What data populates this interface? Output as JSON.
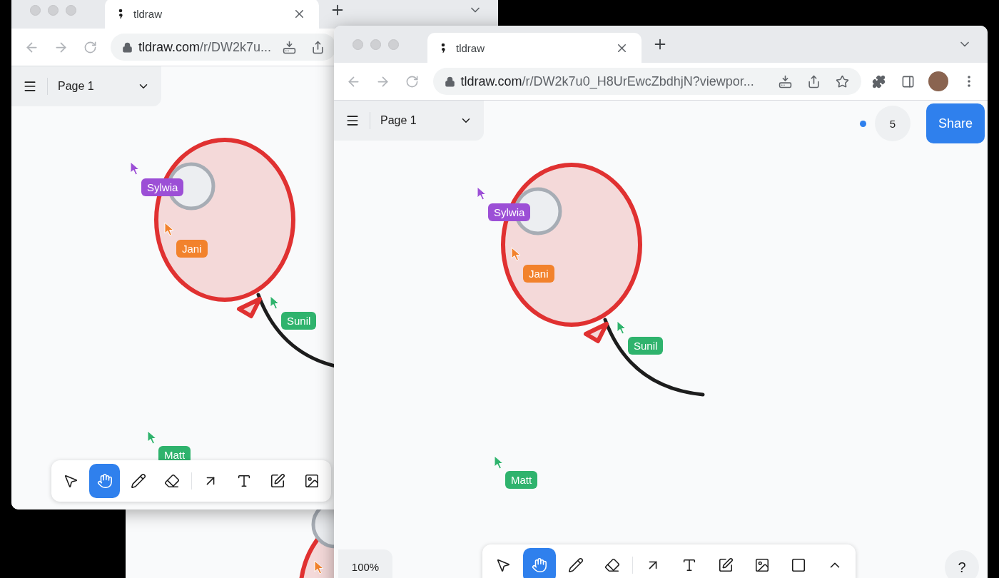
{
  "windows": [
    {
      "tab": {
        "title": "tldraw"
      },
      "url": {
        "host": "tldraw.com",
        "path": "/r/DW2k7u..."
      },
      "page_menu": {
        "label": "Page 1"
      },
      "cursors": [
        {
          "name": "Sylwia",
          "color": "#9c4fd6"
        },
        {
          "name": "Jani",
          "color": "#f2822c"
        },
        {
          "name": "Sunil",
          "color": "#2fb36d"
        },
        {
          "name": "Matt",
          "color": "#2fb36d"
        }
      ],
      "tools": [
        {
          "kind": "select",
          "selected": false
        },
        {
          "kind": "hand",
          "selected": true
        },
        {
          "kind": "draw",
          "selected": false
        },
        {
          "kind": "eraser",
          "selected": false
        },
        {
          "kind": "arrow",
          "selected": false
        },
        {
          "kind": "text",
          "selected": false
        },
        {
          "kind": "note",
          "selected": false
        },
        {
          "kind": "image",
          "selected": false
        }
      ]
    },
    {
      "tab": {
        "title": "tldraw"
      },
      "url": {
        "host": "tldraw.com",
        "path": "/r/DW2k7u0_H8UrEwcZbdhjN?viewpor..."
      },
      "page_menu": {
        "label": "Page 1"
      },
      "presence": {
        "count": "5"
      },
      "share_button": "Share",
      "zoom": "100%",
      "help": "?",
      "cursors": [
        {
          "name": "Sylwia",
          "color": "#9c4fd6"
        },
        {
          "name": "Jani",
          "color": "#f2822c"
        },
        {
          "name": "Sunil",
          "color": "#2fb36d"
        },
        {
          "name": "Matt",
          "color": "#2fb36d"
        }
      ],
      "tools": [
        {
          "kind": "select",
          "selected": false
        },
        {
          "kind": "hand",
          "selected": true
        },
        {
          "kind": "draw",
          "selected": false
        },
        {
          "kind": "eraser",
          "selected": false
        },
        {
          "kind": "arrow",
          "selected": false
        },
        {
          "kind": "text",
          "selected": false
        },
        {
          "kind": "note",
          "selected": false
        },
        {
          "kind": "image",
          "selected": false
        },
        {
          "kind": "rectangle",
          "selected": false
        },
        {
          "kind": "more",
          "selected": false
        }
      ]
    }
  ]
}
